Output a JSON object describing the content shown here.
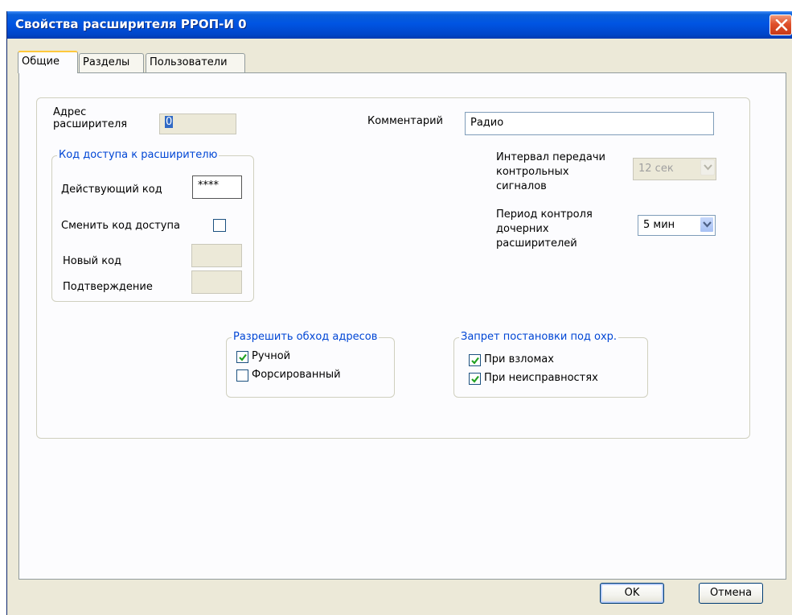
{
  "window": {
    "title": "Свойства расширителя РРОП-И 0"
  },
  "tabs": [
    {
      "label": "Общие",
      "active": true
    },
    {
      "label": "Разделы",
      "active": false
    },
    {
      "label": "Пользователи",
      "active": false
    }
  ],
  "general": {
    "address_label_line1": "Адрес",
    "address_label_line2": "расширителя",
    "address_value": "0",
    "comment_label": "Комментарий",
    "comment_value": "Радио",
    "access_code": {
      "legend": "Код доступа к расширителю",
      "current_code_label": "Действующий код",
      "current_code_value": "****",
      "change_code_label": "Сменить код доступа",
      "change_code_checked": false,
      "new_code_label": "Новый код",
      "new_code_value": "",
      "confirm_label": "Подтверждение",
      "confirm_value": ""
    },
    "control_interval": {
      "label_line1": "Интервал передачи",
      "label_line2": "контрольных",
      "label_line3": "сигналов",
      "value": "12 сек",
      "enabled": false
    },
    "child_control_period": {
      "label_line1": "Период контроля",
      "label_line2": "дочерних",
      "label_line3": "расширителей",
      "value": "5 мин",
      "enabled": true
    },
    "bypass": {
      "legend": "Разрешить обход адресов",
      "manual_label": "Ручной",
      "manual_checked": true,
      "forced_label": "Форсированный",
      "forced_checked": false
    },
    "arming_ban": {
      "legend": "Запрет постановки под охр.",
      "intrusion_label": "При взломах",
      "intrusion_checked": true,
      "fault_label": "При неисправностях",
      "fault_checked": true
    }
  },
  "buttons": {
    "ok_label": "OK",
    "cancel_label": "Отмена"
  },
  "colors": {
    "titlebar": "#0054e3",
    "dialog_bg": "#ece9d8",
    "panel_bg": "#fcfcfe",
    "group_legend": "#0046d5",
    "checkmark": "#21a121",
    "close_button": "#e0502b"
  }
}
